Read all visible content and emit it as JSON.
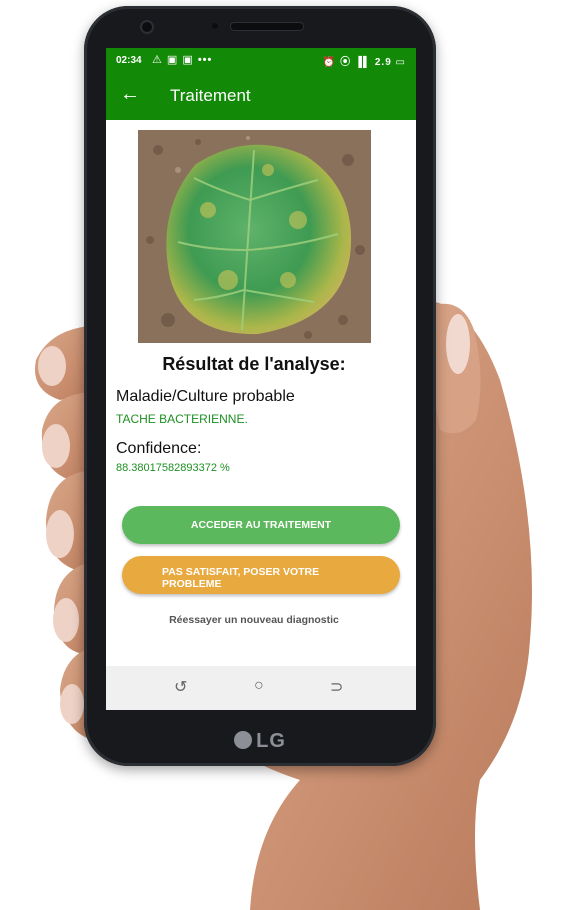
{
  "status_bar": {
    "time": "02:34",
    "left_icons": "⚠ ▣ ▣ •••",
    "right_icons": "⏰ ⦿ ▐▌ 2.9 ▭"
  },
  "app_bar": {
    "title": "Traitement"
  },
  "result": {
    "heading": "Résultat de l'analyse:",
    "disease_label": "Maladie/Culture probable",
    "disease_value": "TACHE BACTERIENNE.",
    "confidence_label": "Confidence:",
    "confidence_value": "88.38017582893372 %"
  },
  "actions": {
    "treatment_label": "ACCEDER AU TRAITEMENT",
    "problem_label": "PAS SATISFAIT, POSER VOTRE PROBLEME",
    "retry_label": "Réessayer un nouveau diagnostic"
  },
  "device": {
    "brand": "LG"
  },
  "nav": {
    "recent": "↺",
    "home": "○",
    "back": "⊃"
  },
  "colors": {
    "primary": "#138a07",
    "treatment_button": "#5cb85c",
    "problem_button": "#e8a93e",
    "result_text": "#1d8f22"
  }
}
